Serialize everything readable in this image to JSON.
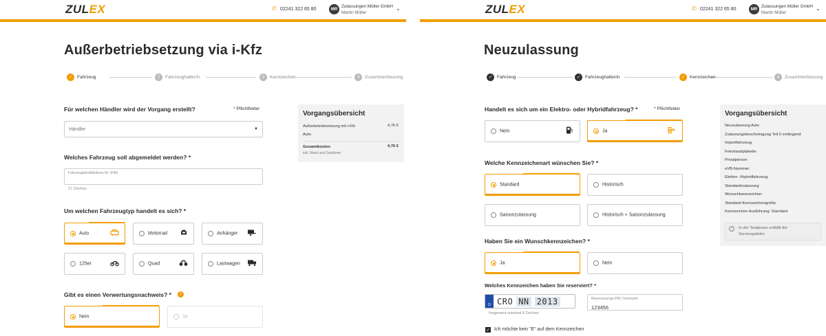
{
  "header": {
    "logo_main": "ZUL",
    "logo_accent": "EX",
    "phone": "02241 322 65 80",
    "avatar_initials": "MR",
    "company": "Zulassungen Müller GmbH",
    "user": "Martin Müller"
  },
  "colors": {
    "accent": "#f39c00",
    "dark": "#2b2b2b",
    "summary_bg": "#f2f2f2"
  },
  "left": {
    "title": "Außerbetriebsetzung via i-Kfz",
    "steps": [
      {
        "num": "",
        "label": "Fahrzeug",
        "state": "current"
      },
      {
        "num": "2",
        "label": "Fahrzeughalter/in",
        "state": "upcoming"
      },
      {
        "num": "3",
        "label": "Kennzeichen",
        "state": "upcoming"
      },
      {
        "num": "4",
        "label": "Zusammenfassung",
        "state": "upcoming"
      }
    ],
    "q_dealer": "Für welchen Händler wird der Vorgang erstellt?",
    "required_note": "* Pflichtfelder",
    "dealer_placeholder": "Händler",
    "q_vehicle": "Welches Fahrzeug soll abgemeldet werden? *",
    "vin_label": "Fahrzeugidentifikations-Nr. (FIN)",
    "vin_hint": "17 Zeichen",
    "q_type": "Um welchen Fahrzeugtyp handelt es sich? *",
    "types": [
      {
        "label": "Auto",
        "icon": "car-icon",
        "selected": true
      },
      {
        "label": "Motorrad",
        "icon": "motorcycle-icon",
        "selected": false
      },
      {
        "label": "Anhänger",
        "icon": "trailer-icon",
        "selected": false
      },
      {
        "label": "125er",
        "icon": "scooter-icon",
        "selected": false
      },
      {
        "label": "Quad",
        "icon": "quad-icon",
        "selected": false
      },
      {
        "label": "Lastwagen",
        "icon": "truck-icon",
        "selected": false
      }
    ],
    "q_recycling": "Gibt es einen Verwertungsnachweis? *",
    "recycling_options": [
      {
        "label": "Nein",
        "selected": true
      },
      {
        "label": "Ja",
        "selected": false,
        "disabled": true
      }
    ],
    "summary": {
      "title": "Vorgangsübersicht",
      "item_label": "Außerbetriebsetzung mit i-Kfz",
      "item_price": "4,76 €",
      "item_sub": "Auto",
      "total_label": "Gesamtkosten",
      "total_price": "4,76 €",
      "total_note": "inkl. Mwst und Gebühren"
    }
  },
  "right": {
    "title": "Neuzulassung",
    "steps": [
      {
        "num": "",
        "label": "Fahrzeug",
        "state": "done"
      },
      {
        "num": "",
        "label": "Fahrzeughalter/in",
        "state": "done"
      },
      {
        "num": "",
        "label": "Kennzeichen",
        "state": "current"
      },
      {
        "num": "4",
        "label": "Zusammenfassung",
        "state": "upcoming"
      }
    ],
    "q_electric": "Handelt es sich um ein Elektro- oder Hybridfahrzeug? *",
    "required_note": "* Pflichtfelder",
    "electric_options": [
      {
        "label": "Nein",
        "icon": "fuel-pump-icon",
        "selected": false
      },
      {
        "label": "Ja",
        "icon": "ev-charging-icon",
        "selected": true
      }
    ],
    "q_plate_type": "Welche Kennzeichenart wünschen Sie? *",
    "plate_types": [
      {
        "label": "Standard",
        "selected": true
      },
      {
        "label": "Historisch",
        "selected": false
      },
      {
        "label": "Saisonzulassung",
        "selected": false
      },
      {
        "label": "Historisch + Saisonzulassung",
        "selected": false
      }
    ],
    "q_wish": "Haben Sie ein Wunschkennzeichen? *",
    "wish_options": [
      {
        "label": "Ja",
        "selected": true
      },
      {
        "label": "Nein",
        "selected": false
      }
    ],
    "q_reserved": "Welches Kennzeichen haben Sie reserviert? *",
    "plate": {
      "country": "D",
      "city": "CRO",
      "letters": "NN",
      "numbers": "2013",
      "hint": "Insgesamt maximal 8 Zeichen"
    },
    "pin_label": "Reservierungs-PIN / Kennwort",
    "pin_value": "123456",
    "no_e_label": "Ich möchte kein \"E\" auf dem Kennzeichen",
    "summary": {
      "title": "Vorgangsübersicht",
      "lines": [
        "Neuzulassung Auto",
        "Zulassungsbescheinigung Teil II vorliegend",
        "Importfahrzeug",
        "Feinstaubplakette",
        "Privatperson",
        "eVB-Nummer:",
        "Elektro- /Hybridfahrzeug",
        "Standardzulassung",
        "Wunschkennzeichen:",
        "Standard-Kennzeichengröße",
        "Kennzeichen Ausführung: Standard"
      ],
      "notice": "In der Testphase entfällt die Servicegebühr."
    }
  }
}
